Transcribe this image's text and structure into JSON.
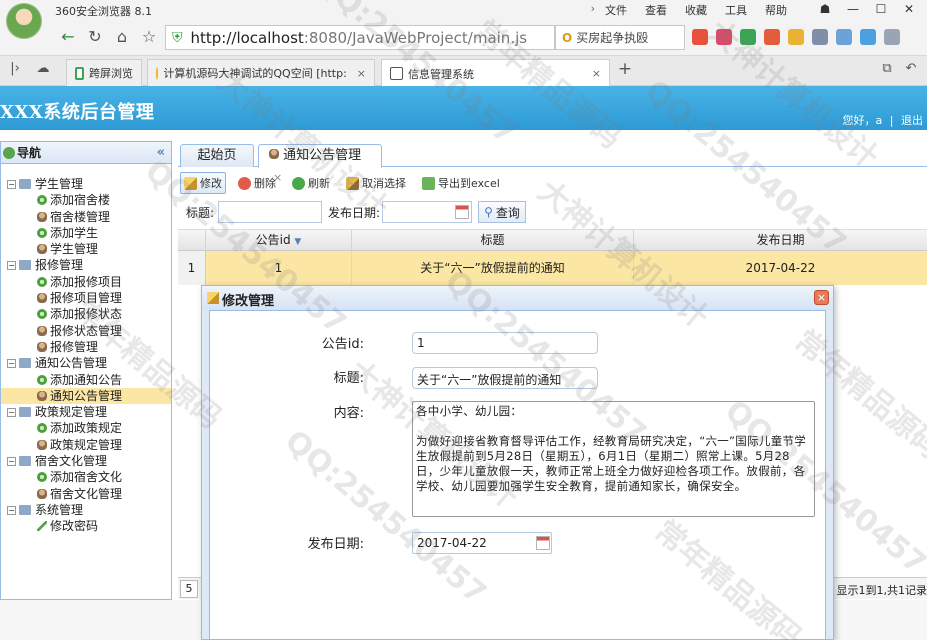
{
  "browser": {
    "name": "360安全浏览器 8.1",
    "menu": [
      "文件",
      "查看",
      "收藏",
      "工具",
      "帮助"
    ],
    "url_host": "http://localhost",
    "url_rest": ":8080/JavaWebProject/main.js",
    "search_placeholder": "买房起争执殴",
    "tabs": [
      {
        "label": "跨屏浏览"
      },
      {
        "label": "计算机源码大神调试的QQ空间 [http:"
      },
      {
        "label": "信息管理系统"
      }
    ],
    "new_tab": "+"
  },
  "header": {
    "title": "XXX系统后台管理",
    "greeting": "您好，a",
    "logout": "退出"
  },
  "sidebar": {
    "title": "导航",
    "collapse": "«",
    "groups": [
      {
        "label": "学生管理",
        "items": [
          {
            "label": "添加宿舍楼",
            "icon": "add"
          },
          {
            "label": "宿舍楼管理",
            "icon": "user"
          },
          {
            "label": "添加学生",
            "icon": "add"
          },
          {
            "label": "学生管理",
            "icon": "user"
          }
        ]
      },
      {
        "label": "报修管理",
        "items": [
          {
            "label": "添加报修项目",
            "icon": "add"
          },
          {
            "label": "报修项目管理",
            "icon": "user"
          },
          {
            "label": "添加报修状态",
            "icon": "add"
          },
          {
            "label": "报修状态管理",
            "icon": "user"
          },
          {
            "label": "报修管理",
            "icon": "user"
          }
        ]
      },
      {
        "label": "通知公告管理",
        "items": [
          {
            "label": "添加通知公告",
            "icon": "add"
          },
          {
            "label": "通知公告管理",
            "icon": "user",
            "selected": true
          }
        ]
      },
      {
        "label": "政策规定管理",
        "items": [
          {
            "label": "添加政策规定",
            "icon": "add"
          },
          {
            "label": "政策规定管理",
            "icon": "user"
          }
        ]
      },
      {
        "label": "宿舍文化管理",
        "items": [
          {
            "label": "添加宿舍文化",
            "icon": "add"
          },
          {
            "label": "宿舍文化管理",
            "icon": "user"
          }
        ]
      },
      {
        "label": "系统管理",
        "items": [
          {
            "label": "修改密码",
            "icon": "pen"
          }
        ]
      }
    ]
  },
  "main": {
    "tabs": [
      {
        "label": "起始页"
      },
      {
        "label": "通知公告管理",
        "close": "×"
      }
    ],
    "toolbar": {
      "edit": "修改",
      "delete": "删除",
      "refresh": "刷新",
      "deselect": "取消选择",
      "export": "导出到excel"
    },
    "search": {
      "title_label": "标题:",
      "date_label": "发布日期:",
      "query": "查询"
    },
    "grid": {
      "columns": [
        "公告id",
        "标题",
        "发布日期"
      ],
      "rows": [
        {
          "num": "1",
          "id": "1",
          "title": "关于“六一”放假提前的通知",
          "date": "2017-04-22"
        }
      ]
    },
    "pager": {
      "page": "5",
      "info": "显示1到1,共1记录"
    }
  },
  "dialog": {
    "title": "修改管理",
    "close": "×",
    "id_label": "公告id:",
    "id_value": "1",
    "title_label": "标题:",
    "title_value": "关于“六一”放假提前的通知",
    "content_label": "内容:",
    "content_value": "各中小学、幼儿园：\n\n为做好迎接省教育督导评估工作，经教育局研究决定，“六一”国际儿童节学生放假提前到5月28日（星期五），6月1日（星期二）照常上课。5月28日，少年儿童放假一天，教师正常上班全力做好迎检各项工作。放假前，各学校、幼儿园要加强学生安全教育，提前通知家长，确保安全。",
    "date_label": "发布日期:",
    "date_value": "2017-04-22"
  },
  "watermarks": [
    "QQ:254540457",
    "大神计算机设计",
    "常年精品源码"
  ],
  "colors": {
    "header": "#2e9ad5",
    "selected_row": "#fbe6a4",
    "border": "#99bbe8"
  }
}
